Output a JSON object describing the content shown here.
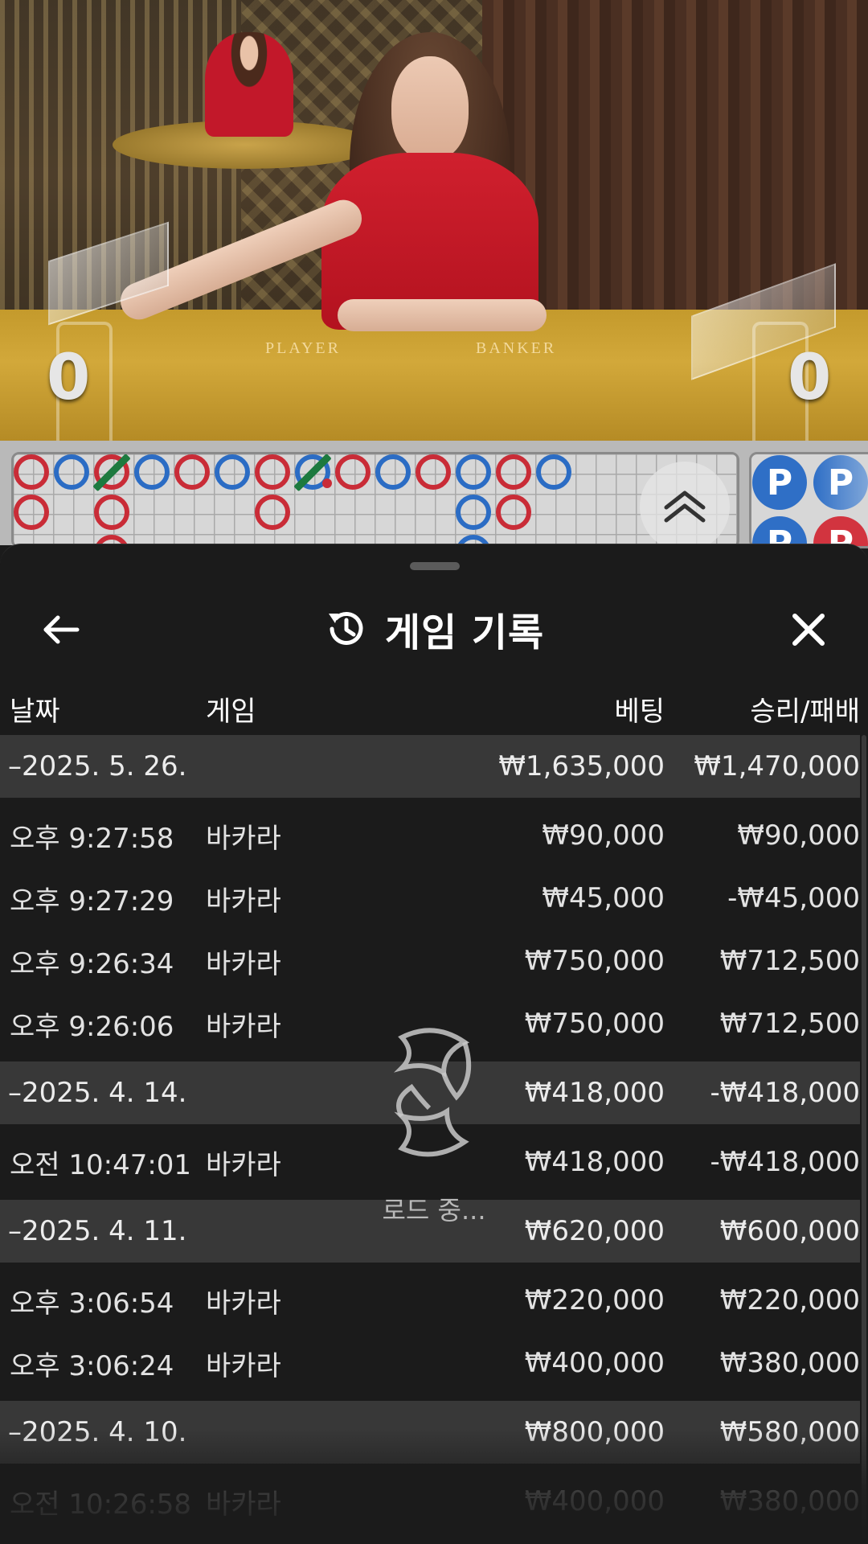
{
  "video": {
    "felt_player_label": "PLAYER",
    "felt_banker_label": "BANKER",
    "player_score": "0",
    "banker_score": "0"
  },
  "roads": {
    "big_road": [
      {
        "col": 0,
        "row": 0,
        "side": "B"
      },
      {
        "col": 1,
        "row": 0,
        "side": "P"
      },
      {
        "col": 2,
        "row": 0,
        "side": "B",
        "tie": true
      },
      {
        "col": 3,
        "row": 0,
        "side": "P"
      },
      {
        "col": 4,
        "row": 0,
        "side": "B"
      },
      {
        "col": 5,
        "row": 0,
        "side": "P"
      },
      {
        "col": 6,
        "row": 0,
        "side": "B"
      },
      {
        "col": 7,
        "row": 0,
        "side": "P",
        "tie": true,
        "dot": true
      },
      {
        "col": 8,
        "row": 0,
        "side": "B"
      },
      {
        "col": 9,
        "row": 0,
        "side": "P"
      },
      {
        "col": 10,
        "row": 0,
        "side": "B"
      },
      {
        "col": 11,
        "row": 0,
        "side": "P"
      },
      {
        "col": 12,
        "row": 0,
        "side": "B"
      },
      {
        "col": 13,
        "row": 0,
        "side": "P"
      },
      {
        "col": 0,
        "row": 1,
        "side": "B"
      },
      {
        "col": 2,
        "row": 1,
        "side": "B"
      },
      {
        "col": 6,
        "row": 1,
        "side": "B"
      },
      {
        "col": 11,
        "row": 1,
        "side": "P"
      },
      {
        "col": 12,
        "row": 1,
        "side": "B"
      },
      {
        "col": 2,
        "row": 2,
        "side": "B"
      },
      {
        "col": 11,
        "row": 2,
        "side": "P"
      }
    ],
    "bead_road": [
      {
        "col": 0,
        "row": 0,
        "label": "P",
        "side": "P"
      },
      {
        "col": 1,
        "row": 0,
        "label": "P",
        "side": "P2"
      },
      {
        "col": 0,
        "row": 1,
        "label": "P",
        "side": "P"
      },
      {
        "col": 1,
        "row": 1,
        "label": "P",
        "side": "B"
      }
    ]
  },
  "sheet": {
    "title": "게임 기록",
    "columns": {
      "date": "날짜",
      "game": "게임",
      "bet": "베팅",
      "win_loss": "승리/패배"
    },
    "groups": [
      {
        "date": "–2025. 5. 26.",
        "bet": "₩1,635,000",
        "win_loss": "₩1,470,000",
        "rows": [
          {
            "time": "오후 9:27:58",
            "game": "바카라",
            "bet": "₩90,000",
            "win_loss": "₩90,000"
          },
          {
            "time": "오후 9:27:29",
            "game": "바카라",
            "bet": "₩45,000",
            "win_loss": "-₩45,000"
          },
          {
            "time": "오후 9:26:34",
            "game": "바카라",
            "bet": "₩750,000",
            "win_loss": "₩712,500"
          },
          {
            "time": "오후 9:26:06",
            "game": "바카라",
            "bet": "₩750,000",
            "win_loss": "₩712,500"
          }
        ]
      },
      {
        "date": "–2025. 4. 14.",
        "bet": "₩418,000",
        "win_loss": "-₩418,000",
        "rows": [
          {
            "time": "오전 10:47:01",
            "game": "바카라",
            "bet": "₩418,000",
            "win_loss": "-₩418,000"
          }
        ]
      },
      {
        "date": "–2025. 4. 11.",
        "bet": "₩620,000",
        "win_loss": "₩600,000",
        "rows": [
          {
            "time": "오후 3:06:54",
            "game": "바카라",
            "bet": "₩220,000",
            "win_loss": "₩220,000"
          },
          {
            "time": "오후 3:06:24",
            "game": "바카라",
            "bet": "₩400,000",
            "win_loss": "₩380,000"
          }
        ]
      },
      {
        "date": "–2025. 4. 10.",
        "bet": "₩800,000",
        "win_loss": "₩580,000",
        "rows": [
          {
            "time": "오전 10:26:58",
            "game": "바카라",
            "bet": "₩400,000",
            "win_loss": "₩380,000"
          }
        ]
      }
    ],
    "loading_text": "로드 중..."
  },
  "colors": {
    "banker": "#c92c37",
    "player": "#2b6cc4",
    "tie": "#1d7a3f",
    "sheet_bg": "#1b1b1b",
    "group_bg": "#383838"
  }
}
